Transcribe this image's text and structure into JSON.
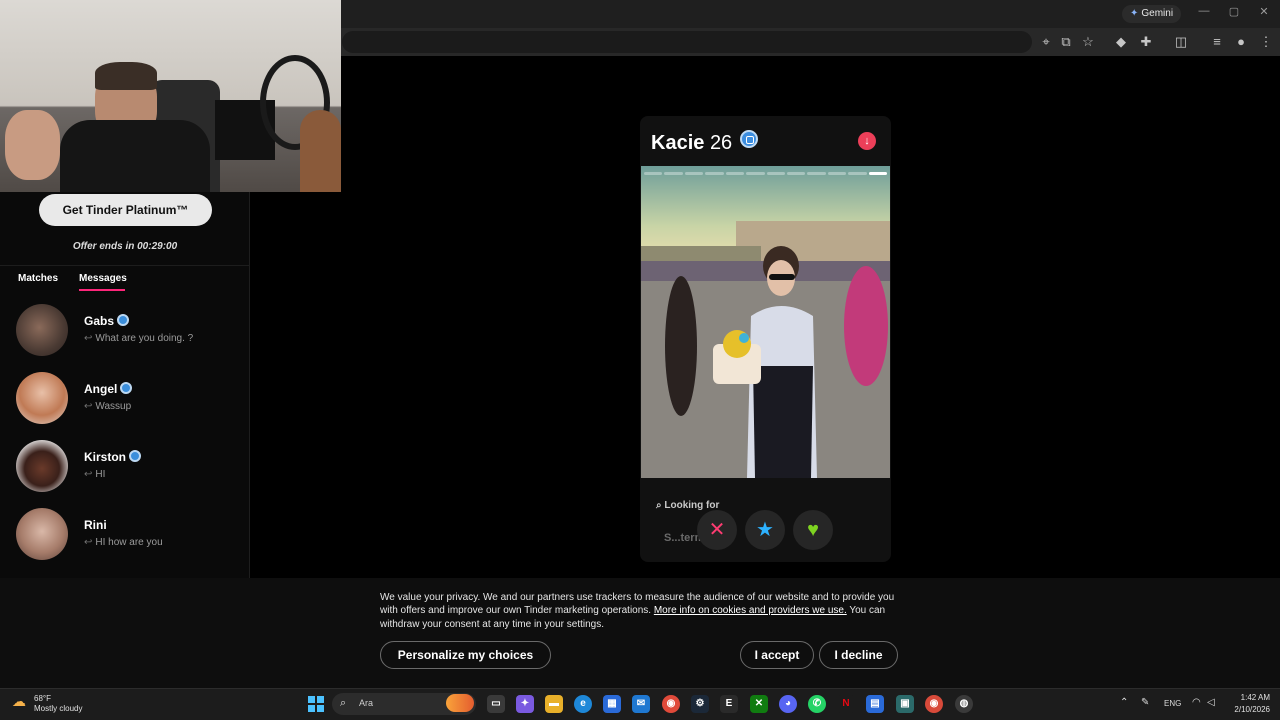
{
  "browser": {
    "gemini_label": "Gemini",
    "icons": [
      "location-icon",
      "install-icon",
      "star-icon",
      "extension-icon",
      "puzzle-icon",
      "sidepanel-icon",
      "media-icon",
      "profile-icon",
      "menu-icon"
    ]
  },
  "sidebar": {
    "platinum_button": "Get Tinder Platinum™",
    "offer_text": "Offer ends in 00:29:00",
    "tabs": [
      {
        "label": "Matches",
        "active": false
      },
      {
        "label": "Messages",
        "active": true
      }
    ],
    "conversations": [
      {
        "name": "Gabs",
        "verified": true,
        "message": "What are you doing. ?"
      },
      {
        "name": "Angel",
        "verified": true,
        "message": "Wassup"
      },
      {
        "name": "Kirston",
        "verified": true,
        "message": "HI"
      },
      {
        "name": "Rini",
        "verified": false,
        "message": "HI how are you"
      }
    ]
  },
  "profile": {
    "name": "Kacie",
    "age": "26",
    "verified": true,
    "photo_count": 12,
    "active_photo": 12,
    "looking_for_label": "Looking for",
    "looking_for_value": "S...term..."
  },
  "actions": {
    "nope": "✕",
    "super_like": "★",
    "like": "♥"
  },
  "cookie_banner": {
    "text_before": "We value your privacy. We and our partners use trackers to measure the audience of our website and to provide you with offers and improve our own Tinder marketing operations. ",
    "link_text": "More info on cookies and providers we use.",
    "text_after": " You can withdraw your consent at any time in your settings.",
    "personalize": "Personalize my choices",
    "accept": "I accept",
    "decline": "I decline"
  },
  "taskbar": {
    "weather_temp": "68°F",
    "weather_desc": "Mostly cloudy",
    "search_placeholder": "Ara",
    "language": "ENG",
    "time": "1:42 AM",
    "date": "2/10/2026"
  },
  "colors": {
    "tinder_pink": "#fd267a",
    "nope": "#fe3c72",
    "super_like": "#2db2ff",
    "like": "#7ed321",
    "verified": "#3c8ee0"
  }
}
